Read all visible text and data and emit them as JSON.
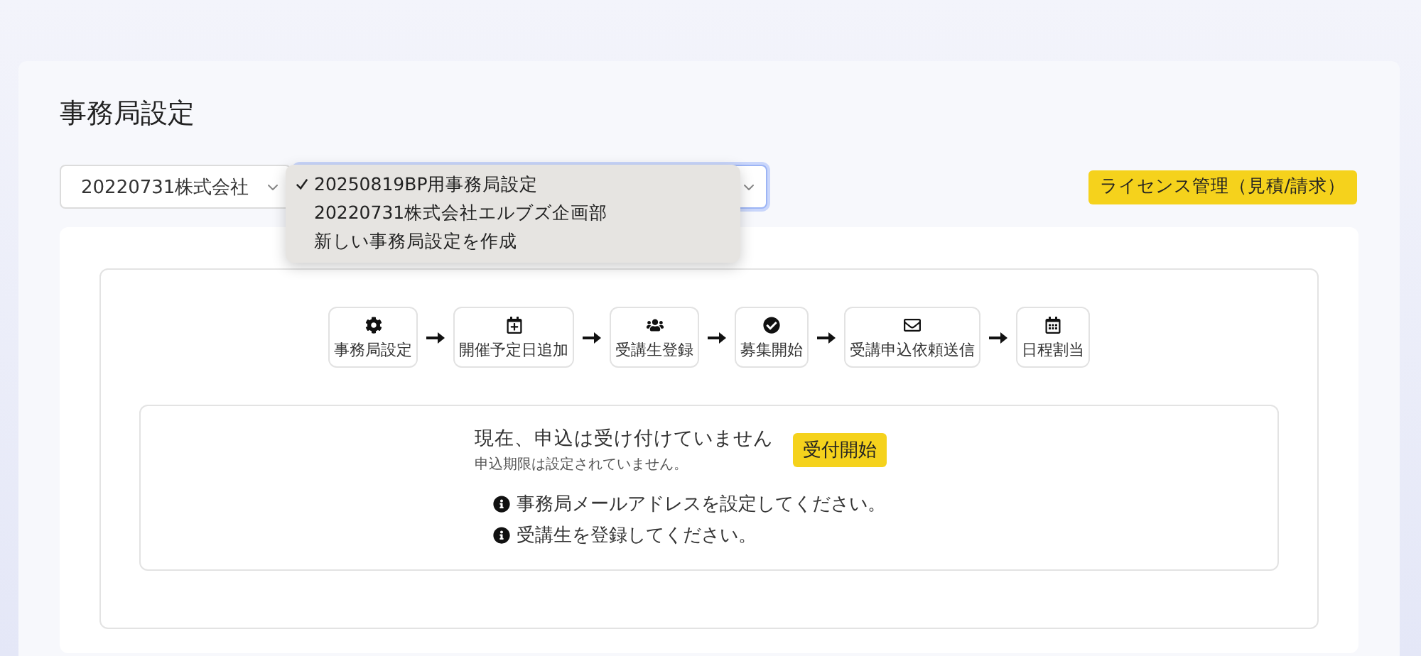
{
  "page": {
    "title": "事務局設定"
  },
  "organization_select": {
    "value": "20220731株式会社"
  },
  "settings_select": {
    "focused": true,
    "menu": [
      {
        "label": "20250819BP用事務局設定",
        "selected": true
      },
      {
        "label": "20220731株式会社エルブズ企画部",
        "selected": false
      },
      {
        "label": "新しい事務局設定を作成",
        "selected": false
      }
    ]
  },
  "license_button": "ライセンス管理（見積/請求）",
  "steps": [
    "事務局設定",
    "開催予定日追加",
    "受講生登録",
    "募集開始",
    "受講申込依頼送信",
    "日程割当"
  ],
  "status": {
    "message": "現在、申込は受け付けていません",
    "note": "申込期限は設定されていません。",
    "button": "受付開始",
    "notices": [
      "事務局メールアドレスを設定してください。",
      "受講生を登録してください。"
    ]
  }
}
